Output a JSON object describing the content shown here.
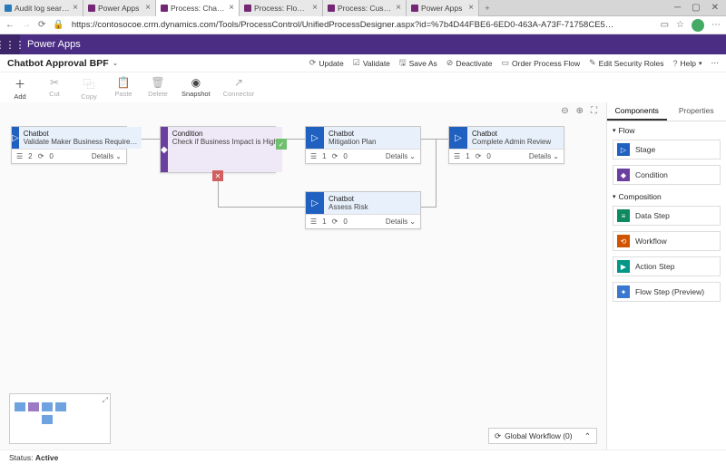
{
  "tabs": [
    {
      "label": "Audit log search - Security"
    },
    {
      "label": "Power Apps"
    },
    {
      "label": "Process: Chatbot Approval",
      "active": true
    },
    {
      "label": "Process: Flow Approval BPF"
    },
    {
      "label": "Process: Custom Connector"
    },
    {
      "label": "Power Apps"
    }
  ],
  "url": "https://contosocoe.crm.dynamics.com/Tools/ProcessControl/UnifiedProcessDesigner.aspx?id=%7b4D44FBE6-6ED0-463A-A73F-71758CE5…",
  "app_name": "Power Apps",
  "process_title": "Chatbot Approval BPF",
  "cmd_actions": {
    "update": "Update",
    "validate": "Validate",
    "save_as": "Save As",
    "deactivate": "Deactivate",
    "order": "Order Process Flow",
    "edit_roles": "Edit Security Roles",
    "help": "Help"
  },
  "toolbar": {
    "add": "Add",
    "cut": "Cut",
    "copy": "Copy",
    "paste": "Paste",
    "delete": "Delete",
    "snapshot": "Snapshot",
    "connector": "Connector"
  },
  "stages": {
    "s1": {
      "type": "Chatbot",
      "title": "Validate Maker Business Require…",
      "steps": "2",
      "loops": "0",
      "details": "Details"
    },
    "cond": {
      "type": "Condition",
      "title": "Check if Business Impact is High"
    },
    "s2": {
      "type": "Chatbot",
      "title": "Mitigation Plan",
      "steps": "1",
      "loops": "0",
      "details": "Details"
    },
    "s3": {
      "type": "Chatbot",
      "title": "Complete Admin Review",
      "steps": "1",
      "loops": "0",
      "details": "Details"
    },
    "s4": {
      "type": "Chatbot",
      "title": "Assess Risk",
      "steps": "1",
      "loops": "0",
      "details": "Details"
    }
  },
  "global_workflow": "Global Workflow (0)",
  "rpanel": {
    "tab1": "Components",
    "tab2": "Properties",
    "sec_flow": "Flow",
    "stage": "Stage",
    "condition": "Condition",
    "sec_comp": "Composition",
    "data_step": "Data Step",
    "workflow": "Workflow",
    "action_step": "Action Step",
    "flow_step": "Flow Step (Preview)"
  },
  "status": {
    "label": "Status:",
    "value": "Active"
  }
}
